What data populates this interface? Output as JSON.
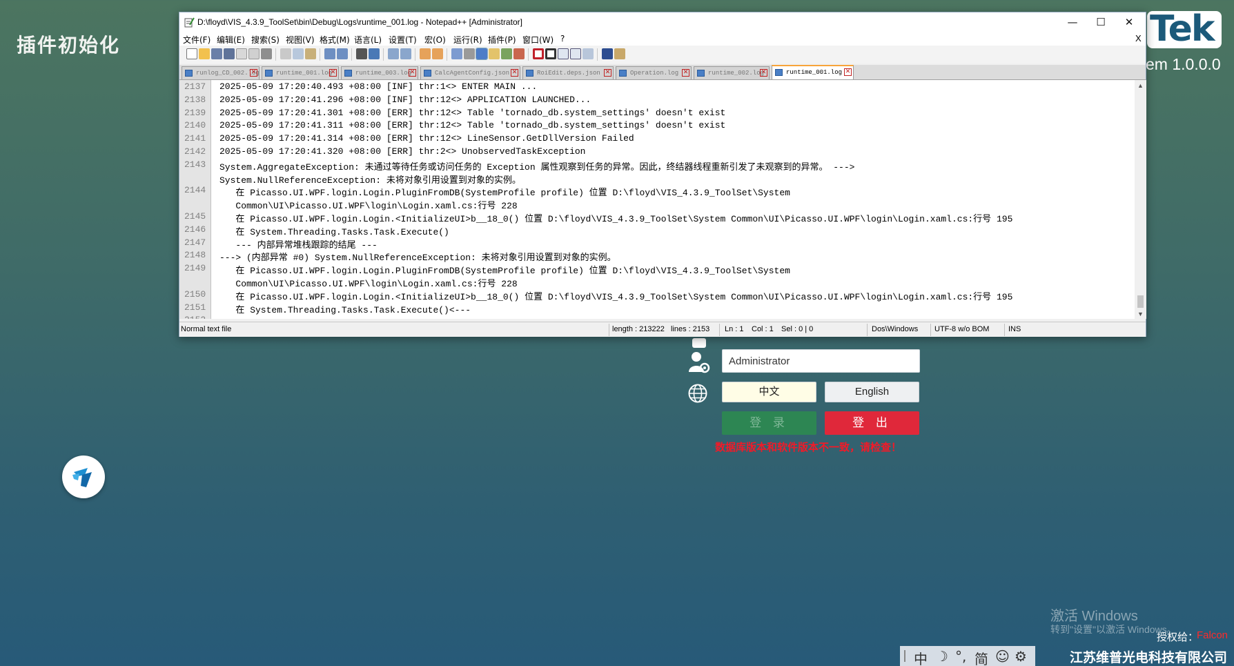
{
  "background_app": {
    "title": "插件初始化",
    "brand": "Tek",
    "version": "em 1.0.0.0",
    "username": "Administrator",
    "lang_cn": "中文",
    "lang_en": "English",
    "login": "登 录",
    "logout": "登 出",
    "error": "数据库版本和软件版本不一致，请检查！",
    "licensed_to_label": "授权给：",
    "licensed_to_value": "Falcon",
    "company": "江苏维普光电科技有限公司",
    "accent_green": "#2d8653",
    "accent_red": "#e0283a"
  },
  "windows_watermark": {
    "title": "激活 Windows",
    "subtitle": "转到\"设置\"以激活 Windows。"
  },
  "ime_bar": {
    "items": [
      "中",
      "☽",
      "°,",
      "简",
      "☺",
      "⚙"
    ]
  },
  "notepad": {
    "title": "D:\\floyd\\VIS_4.3.9_ToolSet\\bin\\Debug\\Logs\\runtime_001.log - Notepad++ [Administrator]",
    "window_controls": {
      "minimize": "—",
      "maximize": "☐",
      "close": "✕"
    },
    "menu": [
      "文件(F)",
      "编辑(E)",
      "搜索(S)",
      "视图(V)",
      "格式(M)",
      "语言(L)",
      "设置(T)",
      "宏(O)",
      "运行(R)",
      "插件(P)",
      "窗口(W)",
      "?"
    ],
    "menu_close": "X",
    "tabs": [
      {
        "label": "runlog_CD_002.log",
        "active": false
      },
      {
        "label": "runtime_001.log",
        "active": false
      },
      {
        "label": "runtime_003.log",
        "active": false
      },
      {
        "label": "CalcAgentConfig.json",
        "active": false
      },
      {
        "label": "RoiEdit.deps.json",
        "active": false
      },
      {
        "label": "Operation.log",
        "active": false
      },
      {
        "label": "runtime_002.log",
        "active": false
      },
      {
        "label": "runtime_001.log",
        "active": true
      }
    ],
    "lines": [
      {
        "num": "2137",
        "text": "2025-05-09 17:20:40.493 +08:00 [INF] thr:1<> ENTER MAIN ..."
      },
      {
        "num": "2138",
        "text": "2025-05-09 17:20:41.296 +08:00 [INF] thr:12<> APPLICATION LAUNCHED..."
      },
      {
        "num": "2139",
        "text": "2025-05-09 17:20:41.301 +08:00 [ERR] thr:12<> Table 'tornado_db.system_settings' doesn't exist"
      },
      {
        "num": "2140",
        "text": "2025-05-09 17:20:41.311 +08:00 [ERR] thr:12<> Table 'tornado_db.system_settings' doesn't exist"
      },
      {
        "num": "2141",
        "text": "2025-05-09 17:20:41.314 +08:00 [ERR] thr:12<> LineSensor.GetDllVersion Failed"
      },
      {
        "num": "2142",
        "text": "2025-05-09 17:20:41.320 +08:00 [ERR] thr:2<> UnobservedTaskException"
      },
      {
        "num": "2143",
        "text": "System.AggregateException: 未通过等待任务或访问任务的 Exception 属性观察到任务的异常。因此，终结器线程重新引发了未观察到的异常。 --->"
      },
      {
        "num": "",
        "text": "System.NullReferenceException: 未将对象引用设置到对象的实例。"
      },
      {
        "num": "2144",
        "text": "   在 Picasso.UI.WPF.login.Login.PluginFromDB(SystemProfile profile) 位置 D:\\floyd\\VIS_4.3.9_ToolSet\\System"
      },
      {
        "num": "",
        "text": "   Common\\UI\\Picasso.UI.WPF\\login\\Login.xaml.cs:行号 228"
      },
      {
        "num": "2145",
        "text": "   在 Picasso.UI.WPF.login.Login.<InitializeUI>b__18_0() 位置 D:\\floyd\\VIS_4.3.9_ToolSet\\System Common\\UI\\Picasso.UI.WPF\\login\\Login.xaml.cs:行号 195"
      },
      {
        "num": "2146",
        "text": "   在 System.Threading.Tasks.Task.Execute()"
      },
      {
        "num": "2147",
        "text": "   --- 内部异常堆栈跟踪的结尾 ---"
      },
      {
        "num": "2148",
        "text": "---> (内部异常 #0) System.NullReferenceException: 未将对象引用设置到对象的实例。"
      },
      {
        "num": "2149",
        "text": "   在 Picasso.UI.WPF.login.Login.PluginFromDB(SystemProfile profile) 位置 D:\\floyd\\VIS_4.3.9_ToolSet\\System"
      },
      {
        "num": "",
        "text": "   Common\\UI\\Picasso.UI.WPF\\login\\Login.xaml.cs:行号 228"
      },
      {
        "num": "2150",
        "text": "   在 Picasso.UI.WPF.login.Login.<InitializeUI>b__18_0() 位置 D:\\floyd\\VIS_4.3.9_ToolSet\\System Common\\UI\\Picasso.UI.WPF\\login\\Login.xaml.cs:行号 195"
      },
      {
        "num": "2151",
        "text": "   在 System.Threading.Tasks.Task.Execute()<---"
      },
      {
        "num": "2152",
        "text": ""
      }
    ],
    "status": {
      "file_type": "Normal text file",
      "length": "length : 213222",
      "lines": "lines : 2153",
      "ln": "Ln : 1",
      "col": "Col : 1",
      "sel": "Sel : 0 | 0",
      "eol": "Dos\\Windows",
      "encoding": "UTF-8 w/o BOM",
      "mode": "INS"
    }
  }
}
